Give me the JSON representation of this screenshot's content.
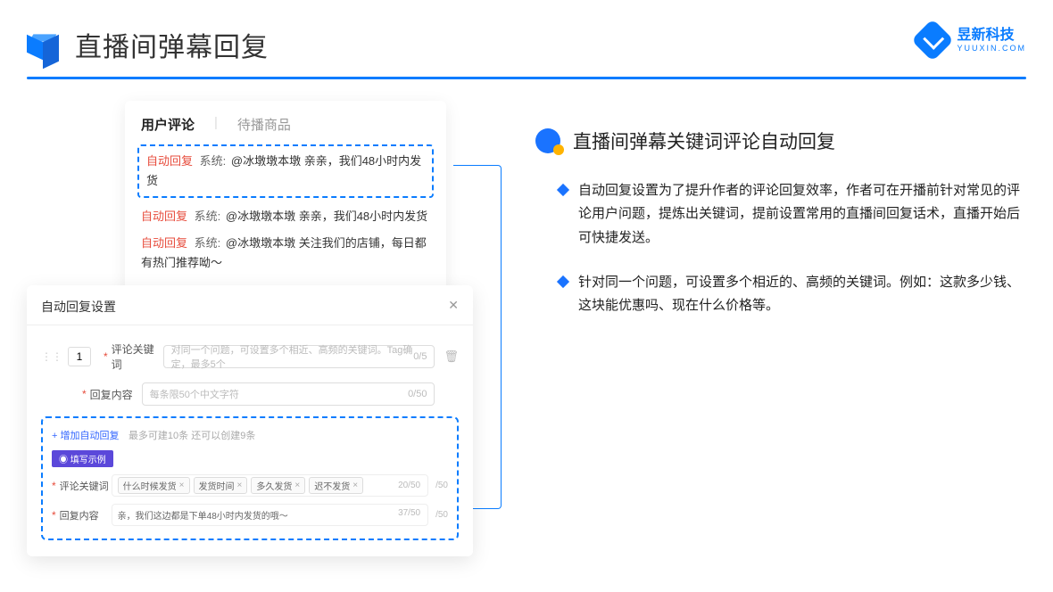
{
  "header": {
    "title": "直播间弹幕回复"
  },
  "brand": {
    "cn": "昱新科技",
    "en": "YUUXIN.COM"
  },
  "comments_panel": {
    "tabs": {
      "user_comments": "用户评论",
      "pending_goods": "待播商品"
    },
    "msgs": [
      {
        "tag": "自动回复",
        "sys": "系统:",
        "body": "@冰墩墩本墩 亲亲，我们48小时内发货"
      },
      {
        "tag": "自动回复",
        "sys": "系统:",
        "body": "@冰墩墩本墩 亲亲，我们48小时内发货"
      },
      {
        "tag": "自动回复",
        "sys": "系统:",
        "body": "@冰墩墩本墩 关注我们的店铺，每日都有热门推荐呦～"
      }
    ]
  },
  "settings_panel": {
    "title": "自动回复设置",
    "num": "1",
    "labels": {
      "keyword": "评论关键词",
      "reply": "回复内容"
    },
    "placeholders": {
      "keyword": "对同一个问题，可设置多个相近、高频的关键词。Tag确定，最多5个",
      "reply": "每条限50个中文字符"
    },
    "counts": {
      "keyword": "0/5",
      "reply": "0/50"
    },
    "add": {
      "text": "+ 增加自动回复",
      "note": "最多可建10条 还可以创建9条"
    },
    "example_badge": "◉ 填写示例",
    "example_tags": [
      "什么时候发货",
      "发货时间",
      "多久发货",
      "迟不发货"
    ],
    "example_tag_count": "20/50",
    "example_reply": "亲，我们这边都是下单48小时内发货的哦～",
    "example_reply_count": "37/50",
    "trailing_count": "/50"
  },
  "feature": {
    "title": "直播间弹幕关键词评论自动回复",
    "bullets": [
      "自动回复设置为了提升作者的评论回复效率，作者可在开播前针对常见的评论用户问题，提炼出关键词，提前设置常用的直播间回复话术，直播开始后可快捷发送。",
      "针对同一个问题，可设置多个相近的、高频的关键词。例如：这款多少钱、这块能优惠吗、现在什么价格等。"
    ]
  }
}
